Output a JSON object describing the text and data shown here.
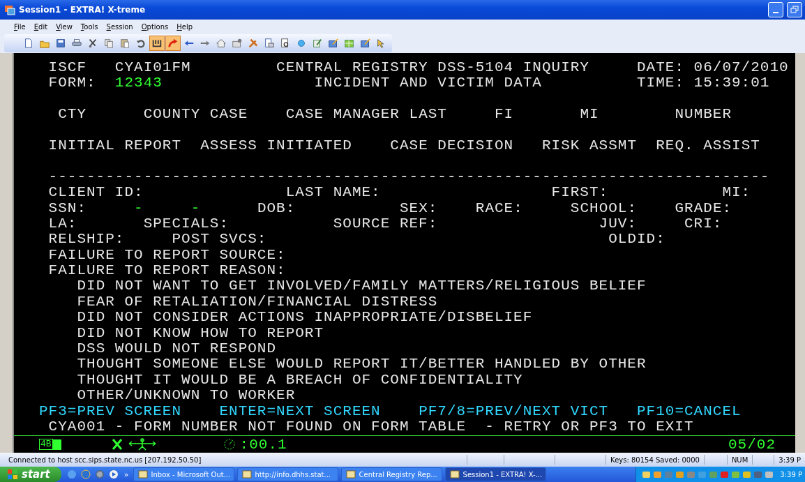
{
  "window": {
    "title": "Session1 - EXTRA! X-treme"
  },
  "menu": [
    "File",
    "Edit",
    "View",
    "Tools",
    "Session",
    "Options",
    "Help"
  ],
  "toolbar": [
    {
      "kind": "new",
      "pressed": false
    },
    {
      "kind": "open",
      "pressed": false
    },
    {
      "kind": "save",
      "pressed": false
    },
    {
      "kind": "print",
      "pressed": false
    },
    {
      "kind": "cut",
      "pressed": false
    },
    {
      "kind": "copy",
      "pressed": false
    },
    {
      "kind": "paste",
      "pressed": false
    },
    {
      "kind": "undo",
      "pressed": false
    },
    {
      "kind": "capture",
      "pressed": true
    },
    {
      "kind": "send",
      "pressed": true
    },
    {
      "kind": "back",
      "pressed": false
    },
    {
      "kind": "forward",
      "pressed": false
    },
    {
      "kind": "home",
      "pressed": false
    },
    {
      "kind": "folder",
      "pressed": false
    },
    {
      "kind": "tools",
      "pressed": false
    },
    {
      "kind": "page",
      "pressed": false
    },
    {
      "kind": "preview",
      "pressed": false
    },
    {
      "kind": "circle",
      "pressed": false
    },
    {
      "kind": "edit",
      "pressed": false
    },
    {
      "kind": "note",
      "pressed": false
    },
    {
      "kind": "grid",
      "pressed": false
    },
    {
      "kind": "note",
      "pressed": false
    },
    {
      "kind": "help",
      "pressed": false
    }
  ],
  "terminal": {
    "blocks": [
      {
        "lines": [
          {
            "segments": [
              {
                "text": " ISCF   CYAI01FM         CENTRAL REGISTRY DSS-5104 INQUIRY     DATE: 06/07/2010",
                "kind": "label"
              }
            ]
          },
          {
            "segments": [
              {
                "text": " FORM:  ",
                "kind": "label"
              },
              {
                "text": "12343",
                "kind": "value"
              },
              {
                "text": "                INCIDENT AND VICTIM DATA          TIME: 15:39:01",
                "kind": "label"
              }
            ]
          }
        ]
      },
      {
        "lines": [
          {
            "segments": [
              {
                "text": "  CTY      COUNTY CASE    CASE MANAGER LAST     FI       MI        NUMBER",
                "kind": "label"
              }
            ]
          }
        ]
      },
      {
        "lines": [
          {
            "segments": [
              {
                "text": " INITIAL REPORT  ASSESS INITIATED    CASE DECISION   RISK ASSMT  REQ. ASSIST",
                "kind": "label"
              }
            ]
          }
        ]
      },
      {
        "lines": [
          {
            "segments": [
              {
                "text": " ----------------------------------------------------------------------------",
                "kind": "label"
              }
            ]
          },
          {
            "segments": [
              {
                "text": " CLIENT ID:               LAST NAME:                  FIRST:            MI:",
                "kind": "label"
              }
            ]
          },
          {
            "segments": [
              {
                "text": " SSN:     ",
                "kind": "label"
              },
              {
                "text": "-     -",
                "kind": "value"
              },
              {
                "text": "      DOB:           SEX:    RACE:     SCHOOL:    GRADE:",
                "kind": "label"
              }
            ]
          },
          {
            "segments": [
              {
                "text": " LA:       SPECIALS:           SOURCE REF:                 JUV:     CRI:",
                "kind": "label"
              }
            ]
          },
          {
            "segments": [
              {
                "text": " RELSHIP:     POST SVCS:                                    OLDID:",
                "kind": "label"
              }
            ]
          },
          {
            "segments": [
              {
                "text": " FAILURE TO REPORT SOURCE:",
                "kind": "label"
              }
            ]
          },
          {
            "segments": [
              {
                "text": " FAILURE TO REPORT REASON:",
                "kind": "label"
              }
            ]
          },
          {
            "segments": [
              {
                "text": "    DID NOT WANT TO GET INVOLVED/FAMILY MATTERS/RELIGIOUS BELIEF",
                "kind": "label"
              }
            ]
          },
          {
            "segments": [
              {
                "text": "    FEAR OF RETALIATION/FINANCIAL DISTRESS",
                "kind": "label"
              }
            ]
          },
          {
            "segments": [
              {
                "text": "    DID NOT CONSIDER ACTIONS INAPPROPRIATE/DISBELIEF",
                "kind": "label"
              }
            ]
          },
          {
            "segments": [
              {
                "text": "    DID NOT KNOW HOW TO REPORT",
                "kind": "label"
              }
            ]
          },
          {
            "segments": [
              {
                "text": "    DSS WOULD NOT RESPOND",
                "kind": "label"
              }
            ]
          },
          {
            "segments": [
              {
                "text": "    THOUGHT SOMEONE ELSE WOULD REPORT IT/BETTER HANDLED BY OTHER",
                "kind": "label"
              }
            ]
          },
          {
            "segments": [
              {
                "text": "    THOUGHT IT WOULD BE A BREACH OF CONFIDENTIALITY",
                "kind": "label"
              }
            ]
          },
          {
            "segments": [
              {
                "text": "    OTHER/UNKNOWN TO WORKER",
                "kind": "label"
              }
            ]
          },
          {
            "segments": [
              {
                "text": "PF3=PREV SCREEN    ENTER=NEXT SCREEN    PF7/8=PREV/NEXT VICT   PF10=CANCEL",
                "kind": "key"
              }
            ]
          },
          {
            "segments": [
              {
                "text": " CYA001 - FORM NUMBER NOT FOUND ON FORM TABLE  - RETRY OR PF3 TO EXIT",
                "kind": "label"
              }
            ]
          }
        ]
      }
    ],
    "oia": {
      "session": "4B",
      "timer": ":00.1",
      "cursor": "05/02"
    }
  },
  "status_bar": {
    "host": "Connected to host scc.sips.state.nc.us [207.192.50.50]",
    "keys": "Keys: 80154  Saved: 0000",
    "num": "NUM",
    "time": "3:39 P"
  },
  "taskbar": {
    "start": "start",
    "more": "»",
    "buttons": [
      {
        "label": "Inbox - Microsoft Out...",
        "selected": false
      },
      {
        "label": "http://info.dhhs.stat...",
        "selected": false
      },
      {
        "label": "Central Registry Rep...",
        "selected": false
      },
      {
        "label": "Session1 - EXTRA! X-...",
        "selected": true
      }
    ],
    "time": "3:39 P"
  }
}
